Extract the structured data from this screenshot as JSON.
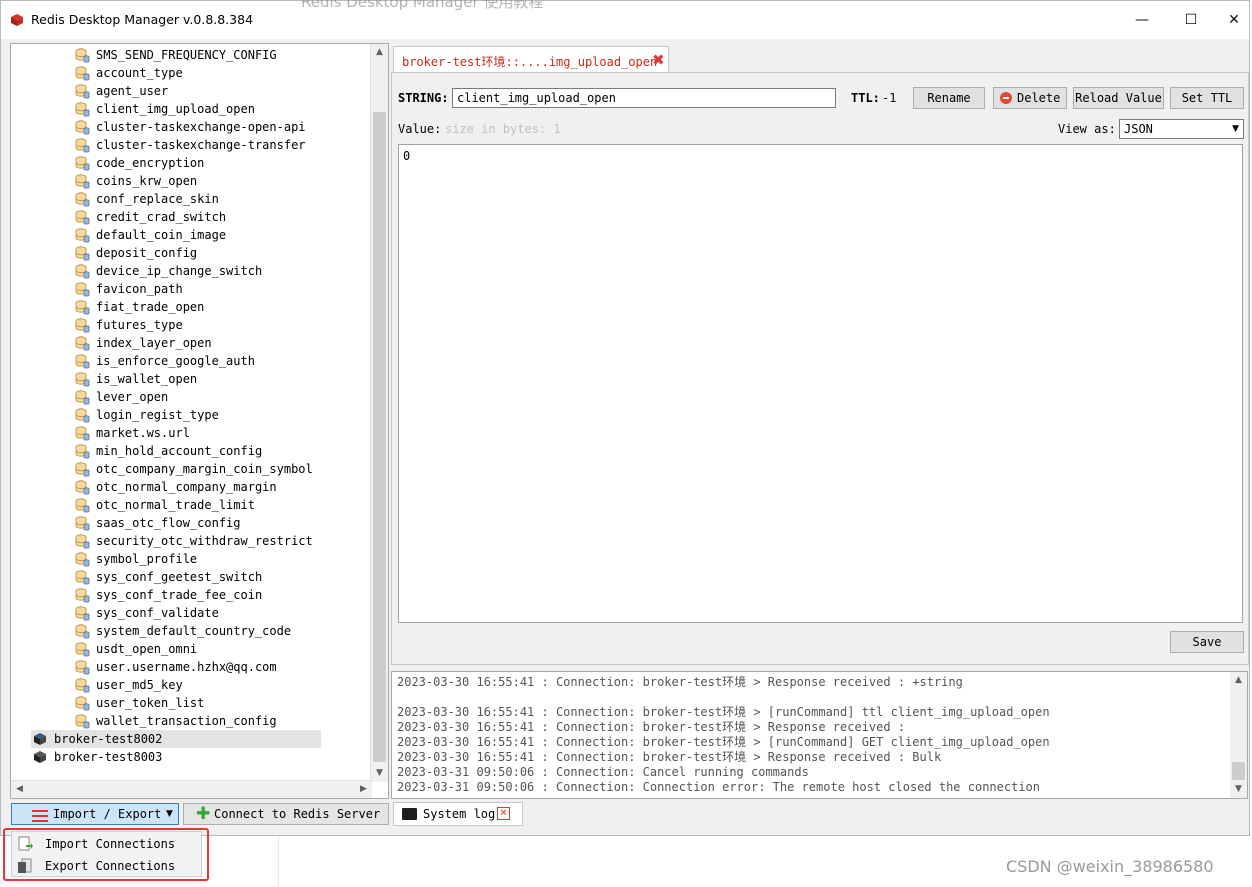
{
  "window": {
    "title": "Redis Desktop Manager v.0.8.8.384",
    "behind_title": "Redis Desktop Manager 使用教程",
    "controls": {
      "minimize": "—",
      "maximize": "☐",
      "close": "✕"
    }
  },
  "tree": {
    "keys": [
      "SMS_SEND_FREQUENCY_CONFIG",
      "account_type",
      "agent_user",
      "client_img_upload_open",
      "cluster-taskexchange-open-api",
      "cluster-taskexchange-transfer",
      "code_encryption",
      "coins_krw_open",
      "conf_replace_skin",
      "credit_crad_switch",
      "default_coin_image",
      "deposit_config",
      "device_ip_change_switch",
      "favicon_path",
      "fiat_trade_open",
      "futures_type",
      "index_layer_open",
      "is_enforce_google_auth",
      "is_wallet_open",
      "lever_open",
      "login_regist_type",
      "market.ws.url",
      "min_hold_account_config",
      "otc_company_margin_coin_symbol",
      "otc_normal_company_margin",
      "otc_normal_trade_limit",
      "saas_otc_flow_config",
      "security_otc_withdraw_restrict",
      "symbol_profile",
      "sys_conf_geetest_switch",
      "sys_conf_trade_fee_coin",
      "sys_conf_validate",
      "system_default_country_code",
      "usdt_open_omni",
      "user.username.hzhx@qq.com",
      "user_md5_key",
      "user_token_list",
      "wallet_transaction_config"
    ],
    "connections": [
      "broker-test8002",
      "broker-test8003"
    ]
  },
  "buttons": {
    "import_export": "Import / Export",
    "connect": "Connect to Redis Server"
  },
  "menu": {
    "import": "Import Connections",
    "export": "Export Connections"
  },
  "tab": {
    "label": "broker-test环境::....img_upload_open",
    "close": "✖"
  },
  "key_view": {
    "type_label": "STRING:",
    "key_name": "client_img_upload_open",
    "ttl_label": "TTL:",
    "ttl_value": "-1",
    "rename": "Rename",
    "delete": "Delete",
    "reload": "Reload Value",
    "set_ttl": "Set TTL",
    "value_label": "Value:",
    "size_hint": "size in bytes: 1",
    "view_as_label": "View as:",
    "view_as_value": "JSON",
    "value_content": "0",
    "save": "Save"
  },
  "log": {
    "lines": [
      "2023-03-30 16:55:41 : Connection: broker-test环境 > Response received : +string",
      "",
      "2023-03-30 16:55:41 : Connection: broker-test环境 > [runCommand] ttl client_img_upload_open",
      "2023-03-30 16:55:41 : Connection: broker-test环境 > Response received :",
      "2023-03-30 16:55:41 : Connection: broker-test环境 > [runCommand] GET client_img_upload_open",
      "2023-03-30 16:55:41 : Connection: broker-test环境 > Response received : Bulk",
      "2023-03-31 09:50:06 : Connection: Cancel running commands",
      "2023-03-31 09:50:06 : Connection: Connection error: The remote host closed the connection"
    ],
    "tab_label": "System log",
    "tab_close": "✕"
  },
  "watermark": "CSDN @weixin_38986580",
  "colors": {
    "accent_red": "#e03a2e",
    "tab_text": "#c42b1c",
    "selection": "#e3e3e3",
    "highlight_box": "#e8343a"
  }
}
